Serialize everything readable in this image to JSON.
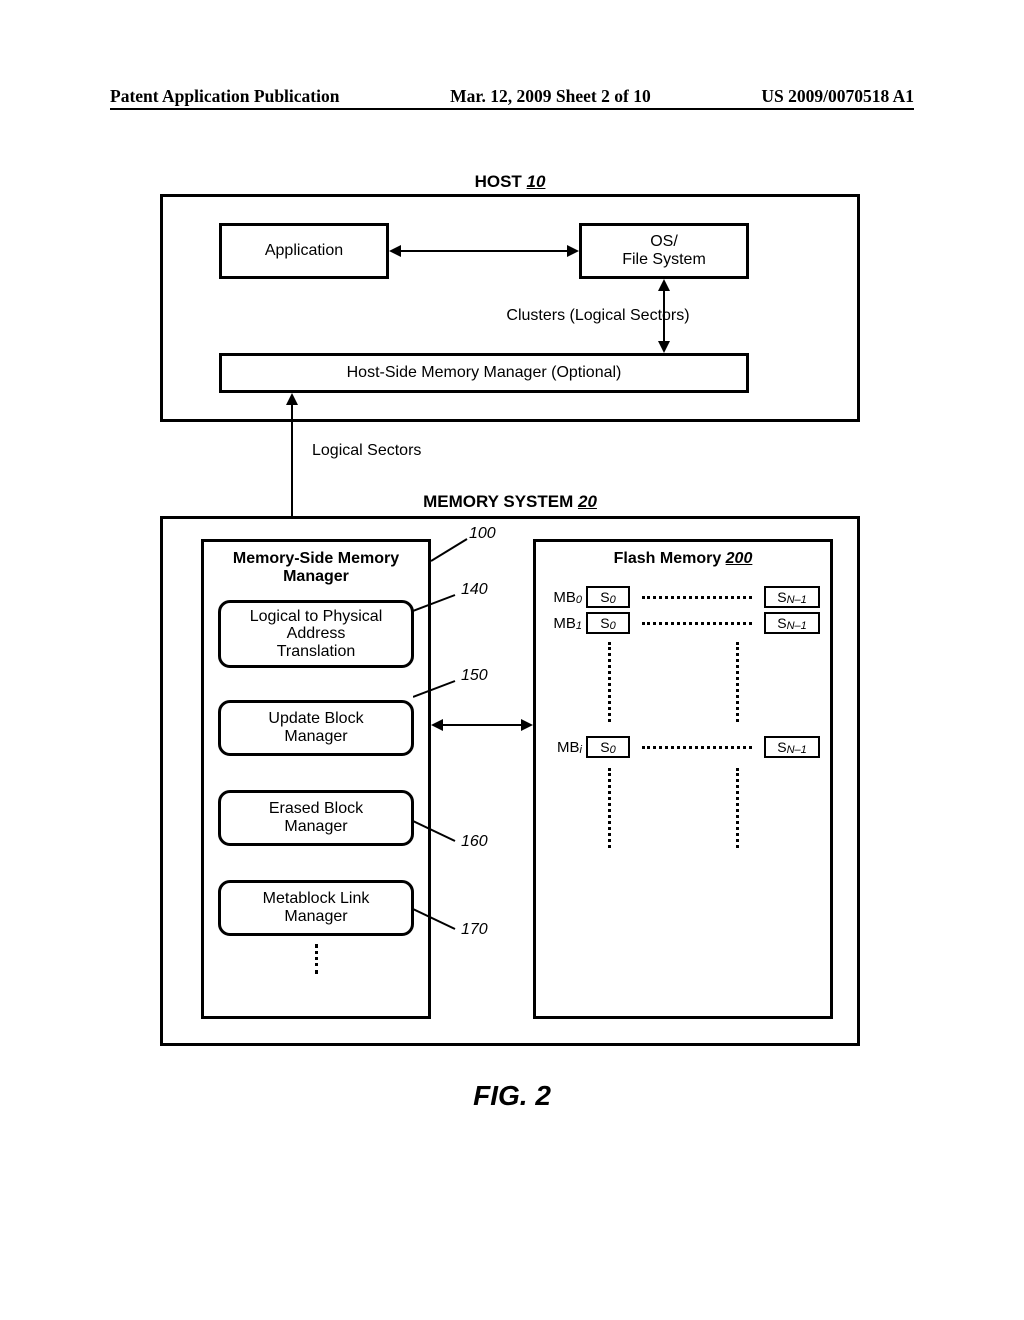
{
  "header": {
    "left": "Patent Application Publication",
    "center": "Mar. 12, 2009  Sheet 2 of 10",
    "right": "US 2009/0070518 A1"
  },
  "host": {
    "title_prefix": "HOST ",
    "title_num": "10",
    "application": "Application",
    "os_fs_line1": "OS/",
    "os_fs_line2": "File System",
    "clusters_label": "Clusters (Logical Sectors)",
    "hsmm": "Host-Side Memory Manager (Optional)"
  },
  "interconnect": {
    "logical_sectors": "Logical Sectors"
  },
  "memory_system": {
    "title_prefix": "MEMORY SYSTEM ",
    "title_num": "20",
    "msmm_line1": "Memory-Side Memory",
    "msmm_line2": "Manager",
    "lpa_line1": "Logical to Physical",
    "lpa_line2": "Address",
    "lpa_line3": "Translation",
    "ubm_line1": "Update Block",
    "ubm_line2": "Manager",
    "ebm_line1": "Erased Block",
    "ebm_line2": "Manager",
    "mlm_line1": "Metablock Link",
    "mlm_line2": "Manager",
    "flash_title_prefix": "Flash Memory ",
    "flash_title_num": "200"
  },
  "callouts": {
    "c100": "100",
    "c140": "140",
    "c150": "150",
    "c160": "160",
    "c170": "170"
  },
  "flash_rows": {
    "mb0": "MB",
    "mb0_sub": "0",
    "mb1": "MB",
    "mb1_sub": "1",
    "mbi": "MB",
    "mbi_sub": "i",
    "s0": "S",
    "s0_sub": "0",
    "sn1": "S",
    "sn1_sub": "N–1"
  },
  "figure_caption": "FIG. 2",
  "chart_data": {
    "type": "diagram",
    "description": "Block diagram of a host computer (10) with Application, OS/File System, and optional Host-Side Memory Manager communicating in logical sectors/clusters to a Memory System (20) containing a Memory-Side Memory Manager (100) with sub-modules Logical-to-Physical Address Translation (140), Update Block Manager (150), Erased Block Manager (160), Metablock Link Manager (170), which interfaces to Flash Memory (200) organized into metablocks MB_0..MB_i each containing sectors S_0..S_{N-1}.",
    "nodes": [
      {
        "id": "host",
        "label": "HOST 10",
        "children": [
          "application",
          "os_fs",
          "hsmm"
        ]
      },
      {
        "id": "application",
        "label": "Application"
      },
      {
        "id": "os_fs",
        "label": "OS/File System"
      },
      {
        "id": "hsmm",
        "label": "Host-Side Memory Manager (Optional)"
      },
      {
        "id": "memory_system",
        "label": "MEMORY SYSTEM 20",
        "children": [
          "msmm",
          "flash"
        ]
      },
      {
        "id": "msmm",
        "label": "Memory-Side Memory Manager",
        "ref": 100,
        "children": [
          "lpa",
          "ubm",
          "ebm",
          "mlm"
        ]
      },
      {
        "id": "lpa",
        "label": "Logical to Physical Address Translation",
        "ref": 140
      },
      {
        "id": "ubm",
        "label": "Update Block Manager",
        "ref": 150
      },
      {
        "id": "ebm",
        "label": "Erased Block Manager",
        "ref": 160
      },
      {
        "id": "mlm",
        "label": "Metablock Link Manager",
        "ref": 170
      },
      {
        "id": "flash",
        "label": "Flash Memory 200",
        "rows": [
          "MB_0: S_0 … S_{N-1}",
          "MB_1: S_0 … S_{N-1}",
          "…",
          "MB_i: S_0 … S_{N-1}",
          "…"
        ]
      }
    ],
    "edges": [
      {
        "from": "application",
        "to": "os_fs",
        "dir": "both"
      },
      {
        "from": "os_fs",
        "to": "hsmm",
        "dir": "both",
        "label": "Clusters (Logical Sectors)"
      },
      {
        "from": "hsmm",
        "to": "msmm",
        "dir": "both",
        "label": "Logical Sectors"
      },
      {
        "from": "ubm",
        "to": "flash",
        "dir": "both"
      }
    ]
  }
}
